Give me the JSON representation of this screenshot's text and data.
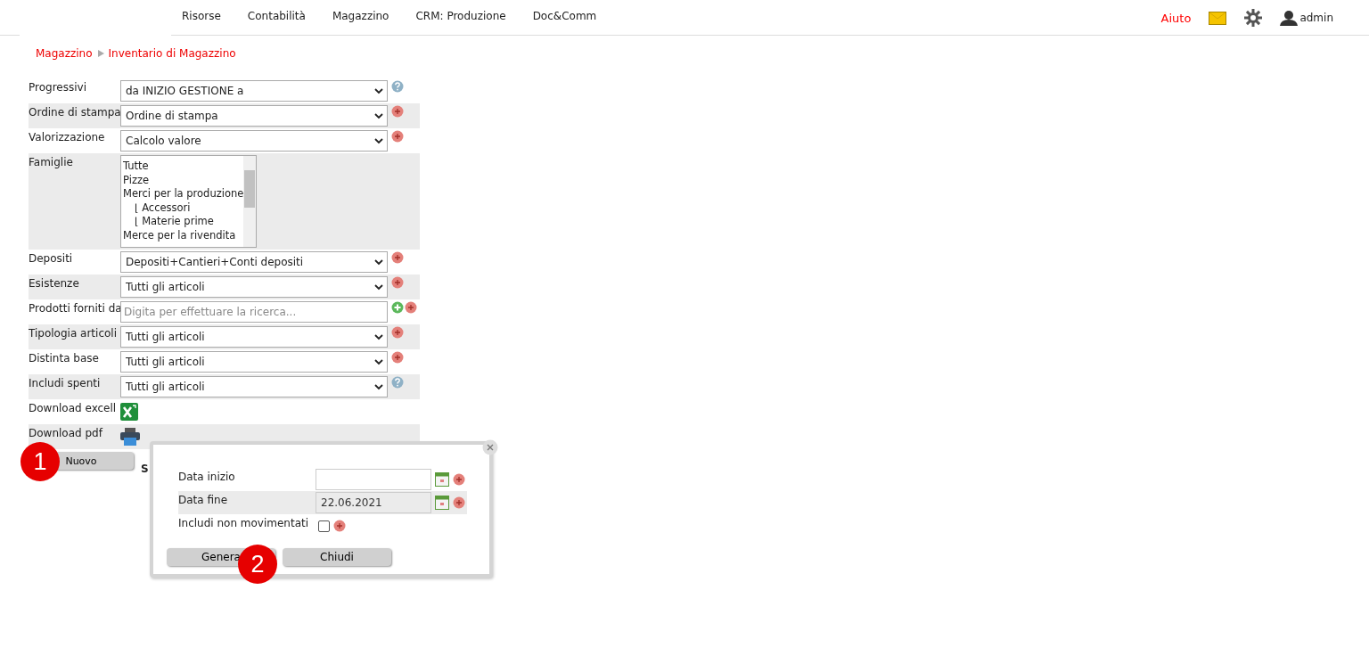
{
  "nav": {
    "items": [
      {
        "label": "Risorse"
      },
      {
        "label": "Contabilità"
      },
      {
        "label": "Magazzino"
      },
      {
        "label": "CRM: Produzione"
      },
      {
        "label": "Doc&Comm"
      }
    ],
    "help": "Aiuto",
    "user": "admin"
  },
  "breadcrumb": [
    {
      "label": "Magazzino"
    },
    {
      "label": "Inventario di Magazzino"
    }
  ],
  "form": [
    {
      "kind": "select",
      "label": "Progressivi",
      "value": "da INIZIO GESTIONE a",
      "icons": [
        {
          "kind": "help"
        }
      ]
    },
    {
      "kind": "select",
      "label": "Ordine di stampa",
      "value": "Ordine di stampa",
      "icons": [
        {
          "kind": "remove"
        }
      ]
    },
    {
      "kind": "select",
      "label": "Valorizzazione",
      "value": "Calcolo valore",
      "icons": [
        {
          "kind": "remove"
        }
      ]
    },
    {
      "kind": "listbox",
      "label": "Famiglie",
      "options": [
        {
          "label": "Tutte"
        },
        {
          "label": "Pizze"
        },
        {
          "label": "Merci per la produzione",
          "children": [
            {
              "label": "⌊ Accessori"
            },
            {
              "label": "⌊ Materie prime"
            }
          ]
        },
        {
          "label": "Merce per la rivendita"
        }
      ]
    },
    {
      "kind": "select",
      "label": "Depositi",
      "value": "Depositi+Cantieri+Conti depositi",
      "icons": [
        {
          "kind": "remove"
        }
      ]
    },
    {
      "kind": "select",
      "label": "Esistenze",
      "value": "Tutti gli articoli",
      "icons": [
        {
          "kind": "remove"
        }
      ]
    },
    {
      "kind": "search",
      "label": "Prodotti forniti da",
      "placeholder": "Digita per effettuare la ricerca...",
      "icons": [
        {
          "kind": "add"
        },
        {
          "kind": "remove"
        }
      ]
    },
    {
      "kind": "select",
      "label": "Tipologia articoli",
      "value": "Tutti gli articoli",
      "icons": [
        {
          "kind": "remove"
        }
      ]
    },
    {
      "kind": "select",
      "label": "Distinta base",
      "value": "Tutti gli articoli",
      "icons": [
        {
          "kind": "remove"
        }
      ]
    },
    {
      "kind": "select",
      "label": "Includi spenti",
      "value": "Tutti gli articoli",
      "icons": [
        {
          "kind": "help"
        }
      ]
    },
    {
      "kind": "excel",
      "label": "Download excell"
    },
    {
      "kind": "pdf",
      "label": "Download pdf"
    }
  ],
  "new_button": "Nuovo",
  "hidden_text": "S",
  "popup": {
    "fields": [
      {
        "kind": "date",
        "label": "Data inizio",
        "disabled": false
      },
      {
        "kind": "date",
        "label": "Data fine",
        "value": "22.06.2021",
        "disabled": true
      },
      {
        "kind": "checkbox",
        "label": "Includi non movimentati",
        "checked": false
      }
    ],
    "buttons": [
      "Genera",
      "Chiudi"
    ]
  },
  "markers": [
    "1",
    "2"
  ]
}
